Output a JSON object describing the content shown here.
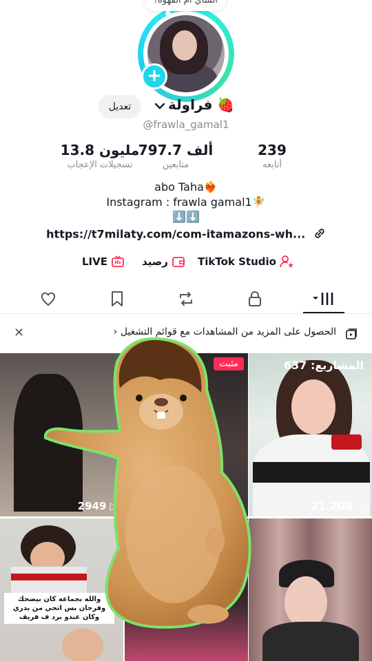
{
  "profile": {
    "note": "الشاي أم القهوة؟",
    "display_name": "فراولة 🍓",
    "username": "@frawla_gamal1",
    "edit_label": "تعديل"
  },
  "stats": [
    {
      "value": "239",
      "label": "أتابعه"
    },
    {
      "value": "797.7 ألف",
      "label": "متابعين"
    },
    {
      "value": "13.8 مليون",
      "label": "تسجيلات الإعجاب"
    }
  ],
  "bio": {
    "line1": "abo Taha❤️‍🔥",
    "line2": "Instagram : frawla gamal1🧚",
    "line3": "⬇️⬇️",
    "link": "https://t7milaty.com/com-itamazons-wh..."
  },
  "quick_links": {
    "studio": "TikTok Studio",
    "balance": "رصيد",
    "live": "LIVE"
  },
  "banner": {
    "text": "الحصول على المزيد من المشاهدات مع قوائم التشغيل"
  },
  "grid": {
    "cells": [
      {
        "views": "",
        "badge": "المشاريع: 637",
        "size": "21.2GB"
      },
      {
        "badge": "مثبت"
      },
      {
        "views": "2949"
      },
      {
        "caption": "والله بجماعه كان بيضحك وفرحان بس اتحي من بدري وكان عندو برد ف فريف"
      }
    ]
  },
  "colors": {
    "accent": "#fe2c55",
    "ring": "#25f4ee",
    "add": "#20d5ec"
  }
}
